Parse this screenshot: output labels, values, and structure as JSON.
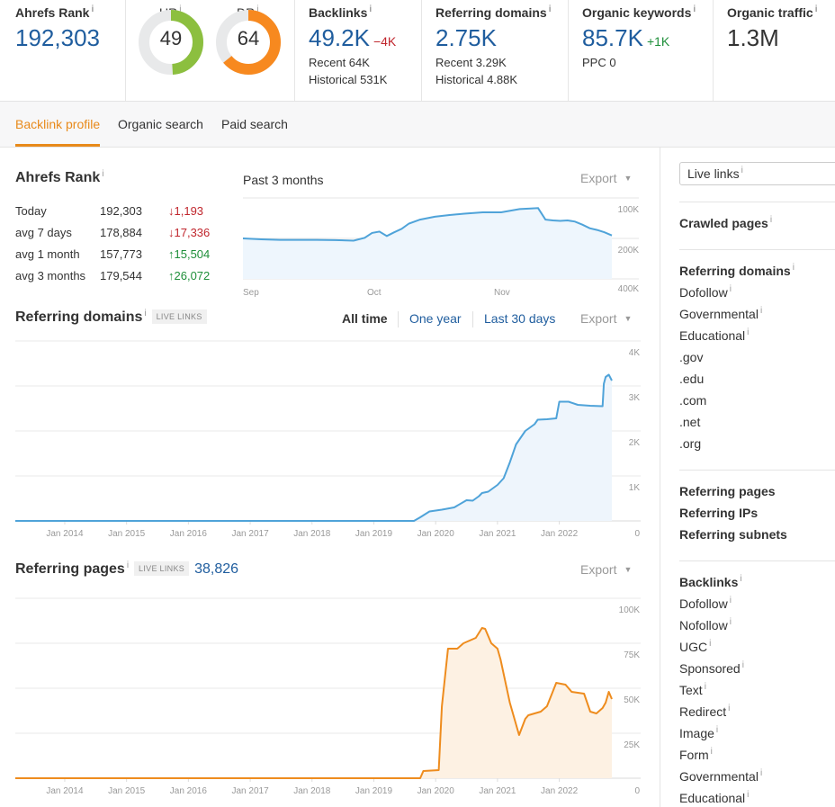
{
  "metrics": {
    "ahrefs_rank": {
      "label": "Ahrefs Rank",
      "value": "192,303"
    },
    "ur": {
      "label": "UR",
      "value": "49",
      "percent": 49,
      "color": "#8cbf3f"
    },
    "dr": {
      "label": "DR",
      "value": "64",
      "percent": 64,
      "color": "#f7891f"
    },
    "backlinks": {
      "label": "Backlinks",
      "value": "49.2K",
      "delta": "−4K",
      "recent": "Recent 64K",
      "historical": "Historical 531K"
    },
    "referring_domains": {
      "label": "Referring domains",
      "value": "2.75K",
      "recent": "Recent 3.29K",
      "historical": "Historical 4.88K"
    },
    "organic_keywords": {
      "label": "Organic keywords",
      "value": "85.7K",
      "delta": "+1K",
      "ppc": "PPC 0"
    },
    "organic_traffic": {
      "label": "Organic traffic",
      "value": "1.3M"
    }
  },
  "info_icon": "i",
  "tabs": [
    {
      "label": "Backlink profile",
      "active": true
    },
    {
      "label": "Organic search",
      "active": false
    },
    {
      "label": "Paid search",
      "active": false
    }
  ],
  "ahrefs_rank_section": {
    "title": "Ahrefs Rank",
    "rows": [
      {
        "label": "Today",
        "value": "192,303",
        "change": "↓1,193",
        "direction": "down"
      },
      {
        "label": "avg 7 days",
        "value": "178,884",
        "change": "↓17,336",
        "direction": "down"
      },
      {
        "label": "avg 1 month",
        "value": "157,773",
        "change": "↑15,504",
        "direction": "up"
      },
      {
        "label": "avg 3 months",
        "value": "179,544",
        "change": "↑26,072",
        "direction": "up"
      }
    ],
    "period_label": "Past 3 months",
    "export_label": "Export"
  },
  "referring_domains_section": {
    "title": "Referring domains",
    "badge": "LIVE LINKS",
    "ranges": [
      "All time",
      "One year",
      "Last 30 days"
    ],
    "active_range": "All time",
    "export_label": "Export"
  },
  "referring_pages_section": {
    "title": "Referring pages",
    "badge": "LIVE LINKS",
    "count": "38,826",
    "export_label": "Export"
  },
  "chart_data": [
    {
      "type": "area",
      "title": "Ahrefs Rank — Past 3 months",
      "x_ticks": [
        "Sep",
        "Oct",
        "Nov"
      ],
      "y_ticks": [
        "100K",
        "200K",
        "400K"
      ],
      "y_scale": "log-inverted",
      "ylim": [
        400000,
        100000
      ],
      "color": "#4fa3d9",
      "fill": "#eef6fd",
      "x": [
        0,
        5,
        10,
        15,
        20,
        25,
        30,
        33,
        35,
        37,
        39,
        41,
        43,
        45,
        48,
        52,
        56,
        60,
        65,
        70,
        75,
        78,
        80,
        82,
        84,
        86,
        88,
        90,
        92,
        94,
        96,
        98,
        100
      ],
      "values": [
        200000,
        203000,
        205000,
        205000,
        205000,
        206000,
        208000,
        198000,
        182000,
        178000,
        192000,
        180000,
        170000,
        155000,
        145000,
        138000,
        134000,
        131000,
        128000,
        128000,
        121000,
        120000,
        119000,
        145000,
        147000,
        148000,
        147000,
        150000,
        158000,
        168000,
        173000,
        180000,
        190000
      ]
    },
    {
      "type": "area",
      "title": "Referring domains",
      "x_ticks": [
        "Jan 2014",
        "Jan 2015",
        "Jan 2016",
        "Jan 2017",
        "Jan 2018",
        "Jan 2019",
        "Jan 2020",
        "Jan 2021",
        "Jan 2022"
      ],
      "y_ticks": [
        "0",
        "1K",
        "2K",
        "3K",
        "4K"
      ],
      "ylim": [
        0,
        4000
      ],
      "xlim": [
        2013.2,
        2022.85
      ],
      "color": "#4fa3d9",
      "fill": "#eef5fc",
      "x": [
        2013.2,
        2019.65,
        2019.75,
        2019.9,
        2020.1,
        2020.3,
        2020.5,
        2020.6,
        2020.7,
        2020.75,
        2020.85,
        2021.0,
        2021.1,
        2021.2,
        2021.3,
        2021.45,
        2021.6,
        2021.65,
        2021.8,
        2021.95,
        2022.0,
        2022.15,
        2022.3,
        2022.5,
        2022.7,
        2022.72,
        2022.75,
        2022.8,
        2022.85
      ],
      "values": [
        0,
        0,
        80,
        210,
        250,
        300,
        460,
        450,
        550,
        620,
        650,
        800,
        950,
        1300,
        1700,
        2000,
        2150,
        2250,
        2260,
        2280,
        2650,
        2650,
        2580,
        2560,
        2550,
        3050,
        3200,
        3250,
        3120
      ]
    },
    {
      "type": "area",
      "title": "Referring pages",
      "x_ticks": [
        "Jan 2014",
        "Jan 2015",
        "Jan 2016",
        "Jan 2017",
        "Jan 2018",
        "Jan 2019",
        "Jan 2020",
        "Jan 2021",
        "Jan 2022"
      ],
      "y_ticks": [
        "0",
        "25K",
        "50K",
        "75K",
        "100K"
      ],
      "ylim": [
        0,
        100000
      ],
      "xlim": [
        2013.2,
        2022.85
      ],
      "color": "#ee8c1e",
      "fill": "#fdf1e3",
      "x": [
        2013.2,
        2019.75,
        2019.8,
        2020.05,
        2020.1,
        2020.2,
        2020.35,
        2020.45,
        2020.65,
        2020.75,
        2020.8,
        2020.9,
        2021.0,
        2021.05,
        2021.2,
        2021.35,
        2021.45,
        2021.5,
        2021.7,
        2021.8,
        2021.95,
        2022.1,
        2022.2,
        2022.4,
        2022.5,
        2022.6,
        2022.7,
        2022.75,
        2022.8,
        2022.85
      ],
      "values": [
        0,
        0,
        4000,
        4500,
        40000,
        72000,
        72000,
        75000,
        78000,
        83500,
        83000,
        75000,
        72000,
        66000,
        42000,
        24000,
        33000,
        35000,
        37000,
        40000,
        53000,
        52000,
        48000,
        47000,
        37000,
        36000,
        39000,
        42000,
        48000,
        44000
      ]
    }
  ],
  "sidebar": {
    "select_value": "Live links",
    "groups": [
      {
        "items": [
          {
            "label": "Crawled pages",
            "bold": true,
            "info": true
          }
        ]
      },
      {
        "items": [
          {
            "label": "Referring domains",
            "bold": true,
            "info": true
          },
          {
            "label": "Dofollow",
            "bold": false,
            "info": true
          },
          {
            "label": "Governmental",
            "bold": false,
            "info": true
          },
          {
            "label": "Educational",
            "bold": false,
            "info": true
          },
          {
            "label": ".gov",
            "bold": false,
            "info": false
          },
          {
            "label": ".edu",
            "bold": false,
            "info": false
          },
          {
            "label": ".com",
            "bold": false,
            "info": false
          },
          {
            "label": ".net",
            "bold": false,
            "info": false
          },
          {
            "label": ".org",
            "bold": false,
            "info": false
          }
        ]
      },
      {
        "items": [
          {
            "label": "Referring pages",
            "bold": true,
            "info": false
          },
          {
            "label": "Referring IPs",
            "bold": true,
            "info": false
          },
          {
            "label": "Referring subnets",
            "bold": true,
            "info": false
          }
        ]
      },
      {
        "items": [
          {
            "label": "Backlinks",
            "bold": true,
            "info": true
          },
          {
            "label": "Dofollow",
            "bold": false,
            "info": true
          },
          {
            "label": "Nofollow",
            "bold": false,
            "info": true
          },
          {
            "label": "UGC",
            "bold": false,
            "info": true
          },
          {
            "label": "Sponsored",
            "bold": false,
            "info": true
          },
          {
            "label": "Text",
            "bold": false,
            "info": true
          },
          {
            "label": "Redirect",
            "bold": false,
            "info": true
          },
          {
            "label": "Image",
            "bold": false,
            "info": true
          },
          {
            "label": "Form",
            "bold": false,
            "info": true
          },
          {
            "label": "Governmental",
            "bold": false,
            "info": true
          },
          {
            "label": "Educational",
            "bold": false,
            "info": true
          }
        ]
      }
    ]
  }
}
